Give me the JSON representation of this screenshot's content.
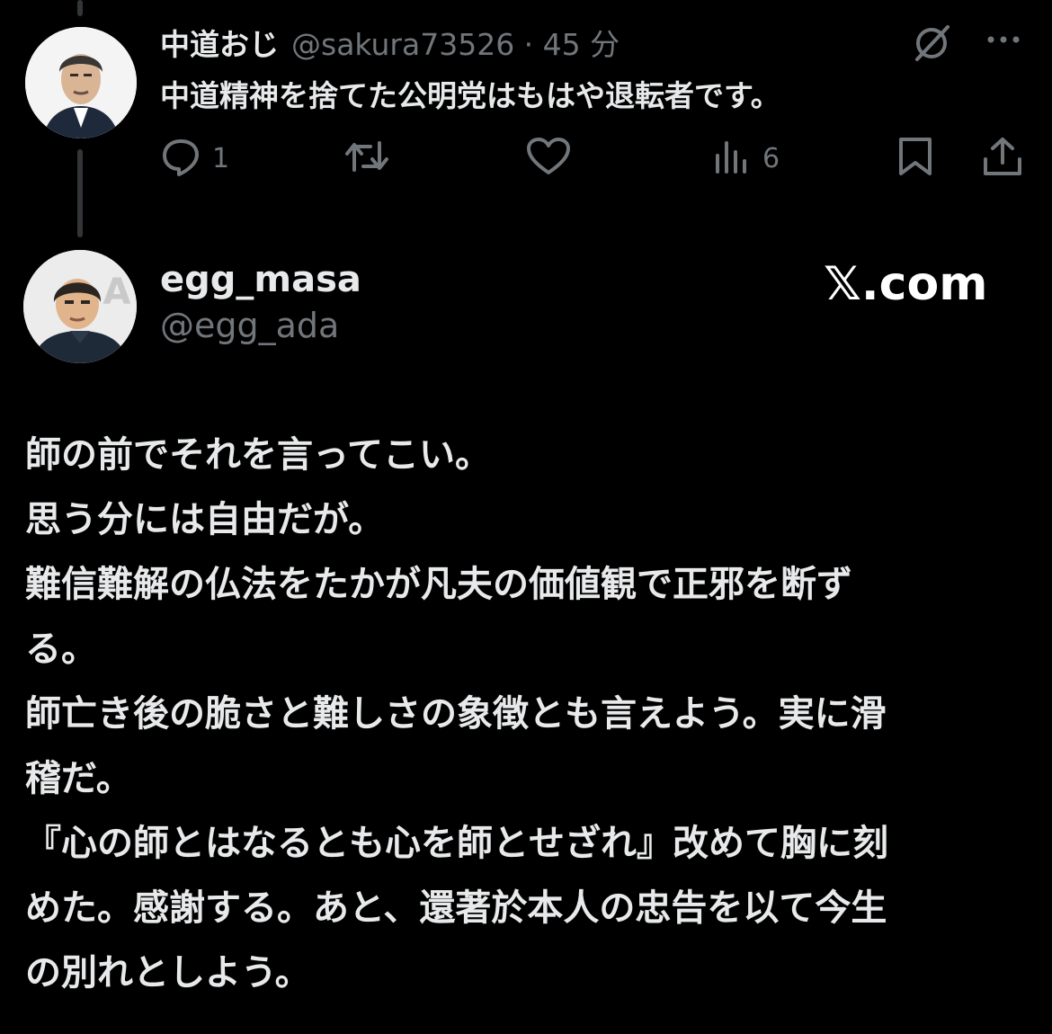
{
  "reply": {
    "display_name": "中道おじ",
    "meta": "@sakura73526 · 45 分",
    "text": "中道精神を捨てた公明党はもはや退転者です。",
    "actions": {
      "reply_count": "1",
      "views_count": "6"
    }
  },
  "quoted": {
    "display_name": "egg_masa",
    "handle": "@egg_ada",
    "watermark": "𝕏.com",
    "lines": [
      "師の前でそれを言ってこい。",
      "思う分には自由だが。",
      "難信難解の仏法をたかが凡夫の価値観で正邪を断ず",
      "る。",
      "師亡き後の脆さと難しさの象徴とも言えよう。実に滑",
      "稽だ。",
      "『心の師とはなるとも心を師とせざれ』改めて胸に刻",
      "めた。感謝する。あと、還著於本人の忠告を以て今生",
      "の別れとしよう。"
    ]
  },
  "icons": {
    "grok": "grok-icon",
    "more": "more-icon",
    "reply": "reply-icon",
    "retweet": "retweet-icon",
    "like": "heart-icon",
    "views": "views-icon",
    "bookmark": "bookmark-icon",
    "share": "share-icon"
  },
  "colors": {
    "background": "#000000",
    "text_primary": "#e7e9ea",
    "text_secondary": "#71767b",
    "thread_line": "#333639"
  }
}
